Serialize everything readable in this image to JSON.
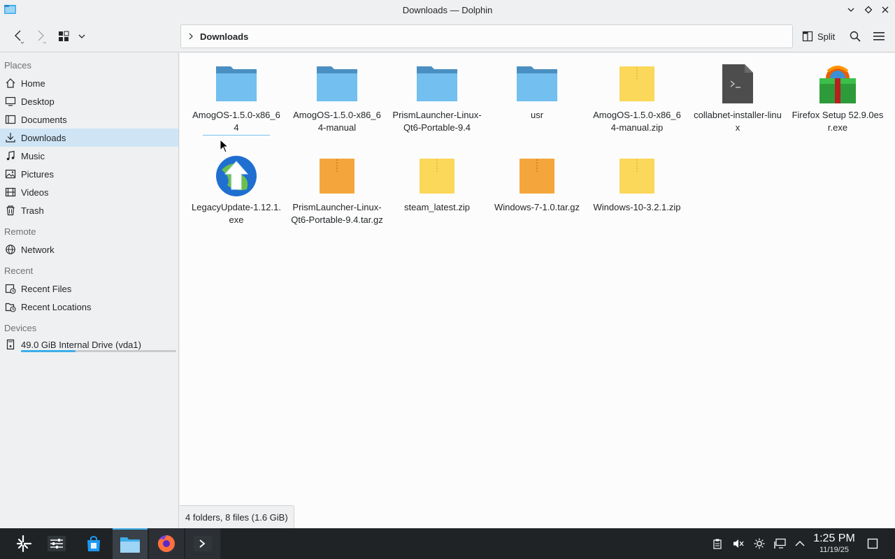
{
  "window": {
    "title": "Downloads — Dolphin"
  },
  "toolbar": {
    "breadcrumb": [
      "Downloads"
    ],
    "split_label": "Split",
    "icons": [
      "back-icon",
      "forward-icon",
      "view-mode-icon",
      "chevron-down-icon",
      "split-icon",
      "search-icon",
      "hamburger-menu-icon"
    ]
  },
  "sidebar": {
    "places_title": "Places",
    "places": [
      {
        "label": "Home",
        "icon": "home-icon"
      },
      {
        "label": "Desktop",
        "icon": "desktop-icon"
      },
      {
        "label": "Documents",
        "icon": "documents-icon"
      },
      {
        "label": "Downloads",
        "icon": "downloads-icon",
        "selected": true
      },
      {
        "label": "Music",
        "icon": "music-icon"
      },
      {
        "label": "Pictures",
        "icon": "pictures-icon"
      },
      {
        "label": "Videos",
        "icon": "videos-icon"
      },
      {
        "label": "Trash",
        "icon": "trash-icon"
      }
    ],
    "remote_title": "Remote",
    "remote": [
      {
        "label": "Network",
        "icon": "network-icon"
      }
    ],
    "recent_title": "Recent",
    "recent": [
      {
        "label": "Recent Files",
        "icon": "recent-files-icon"
      },
      {
        "label": "Recent Locations",
        "icon": "recent-locations-icon"
      }
    ],
    "devices_title": "Devices",
    "devices": [
      {
        "label": "49.0 GiB Internal Drive (vda1)",
        "icon": "drive-icon",
        "usage_fraction": 0.35
      }
    ]
  },
  "files": [
    {
      "name": "AmogOS-1.5.0-x86_64",
      "type": "folder"
    },
    {
      "name": "AmogOS-1.5.0-x86_64-manual",
      "type": "folder"
    },
    {
      "name": "PrismLauncher-Linux-Qt6-Portable-9.4",
      "type": "folder"
    },
    {
      "name": "usr",
      "type": "folder"
    },
    {
      "name": "AmogOS-1.5.0-x86_64-manual.zip",
      "type": "zip"
    },
    {
      "name": "collabnet-installer-linux",
      "type": "script"
    },
    {
      "name": "Firefox Setup 52.9.0esr.exe",
      "type": "exe-firefox"
    },
    {
      "name": "LegacyUpdate-1.12.1.exe",
      "type": "exe-legacy"
    },
    {
      "name": "PrismLauncher-Linux-Qt6-Portable-9.4.tar.gz",
      "type": "tar"
    },
    {
      "name": "steam_latest.zip",
      "type": "zip"
    },
    {
      "name": "Windows-7-1.0.tar.gz",
      "type": "tar"
    },
    {
      "name": "Windows-10-3.2.1.zip",
      "type": "zip"
    }
  ],
  "status": {
    "summary": "4 folders, 8 files (1.6 GiB)"
  },
  "taskbar": {
    "apps": [
      "application-launcher-icon",
      "system-settings-icon",
      "discover-store-icon",
      "dolphin-icon",
      "firefox-icon",
      "konsole-icon"
    ],
    "tray": [
      "clipboard-icon",
      "volume-muted-icon",
      "brightness-icon",
      "network-wired-icon",
      "tray-expand-icon"
    ],
    "clock_time": "1:25 PM",
    "clock_date": "11/19/25",
    "show_desktop_icon": "show-desktop-icon"
  },
  "colors": {
    "accent": "#3daee9",
    "folder": "#72bff0",
    "folder_tab": "#4a8fc2",
    "zip": "#fbd75a",
    "tar": "#f4a63c",
    "selection": "#cfe5f6"
  }
}
